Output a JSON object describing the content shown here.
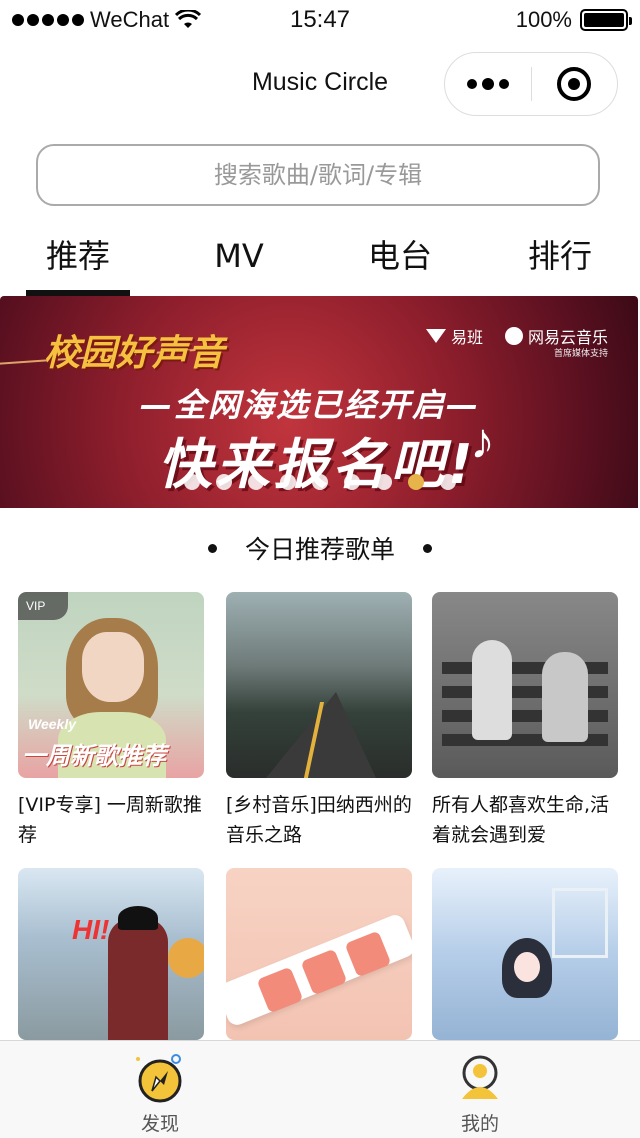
{
  "status_bar": {
    "carrier": "WeChat",
    "time": "15:47",
    "battery": "100%"
  },
  "nav": {
    "title": "Music Circle"
  },
  "search": {
    "placeholder": "搜索歌曲/歌词/专辑"
  },
  "tabs": [
    {
      "label": "推荐",
      "active": true
    },
    {
      "label": "MV",
      "active": false
    },
    {
      "label": "电台",
      "active": false
    },
    {
      "label": "排行",
      "active": false
    }
  ],
  "banner": {
    "event_title": "校园好声音",
    "brand_1": "易班",
    "brand_2": "网易云音乐",
    "brand_sub": "首席媒体支持",
    "line_1": "—全网海选已经开启—",
    "line_2": "快来报名吧!",
    "dot_count": 9,
    "active_dot": 7
  },
  "section": {
    "title": "今日推荐歌单"
  },
  "playlists": [
    {
      "title": "[VIP专享] 一周新歌推荐",
      "vip": "VIP",
      "cover_text": "Weekly",
      "cover_text_cn": "一周新歌推荐"
    },
    {
      "title": "[乡村音乐]田纳西州的音乐之路"
    },
    {
      "title": "所有人都喜欢生命,活着就会遇到爱"
    },
    {
      "title": ""
    },
    {
      "title": ""
    },
    {
      "title": ""
    }
  ],
  "tabbar": [
    {
      "label": "发现",
      "icon": "compass-icon"
    },
    {
      "label": "我的",
      "icon": "user-icon"
    }
  ],
  "colors": {
    "accent_yellow": "#f3c33a",
    "banner_red": "#8e1e2c",
    "dot_active": "#e6b44a"
  }
}
